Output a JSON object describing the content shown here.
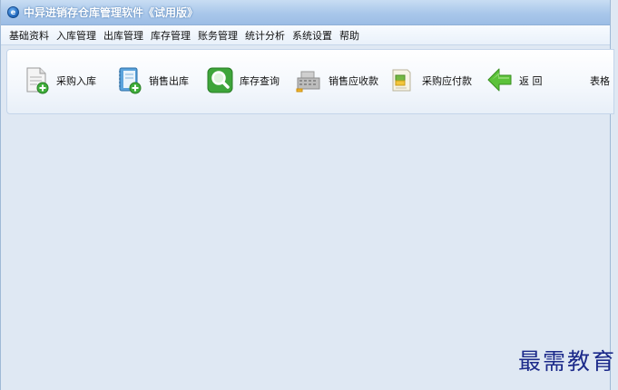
{
  "window": {
    "title": "中异进销存仓库管理软件《试用版》",
    "icon_glyph": "e"
  },
  "menu": [
    "基础资料",
    "入库管理",
    "出库管理",
    "库存管理",
    "账务管理",
    "统计分析",
    "系统设置",
    "帮助"
  ],
  "toolbar": [
    {
      "label": "采购入库",
      "icon": "document-add-icon"
    },
    {
      "label": "销售出库",
      "icon": "notebook-add-icon"
    },
    {
      "label": "库存查询",
      "icon": "magnifier-icon"
    },
    {
      "label": "销售应收款",
      "icon": "cash-register-icon"
    },
    {
      "label": "采购应付款",
      "icon": "ledger-icon"
    },
    {
      "label": "返 回",
      "icon": "back-arrow-icon"
    },
    {
      "label": "表格",
      "icon": ""
    }
  ],
  "watermark": "最需教育"
}
